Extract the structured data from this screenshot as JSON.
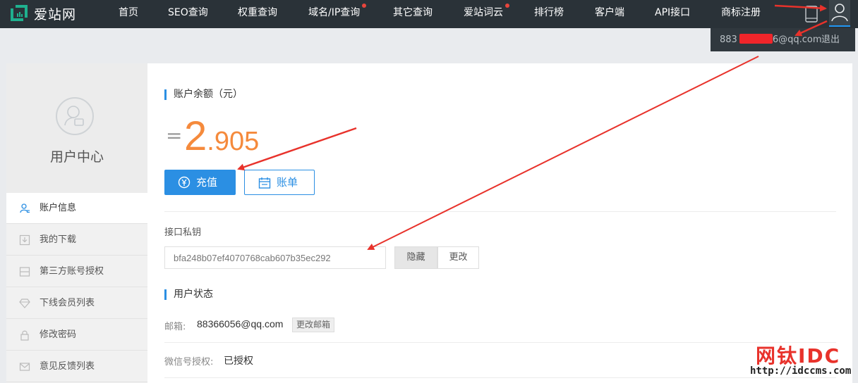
{
  "brand": {
    "name": "爱站网"
  },
  "nav": {
    "items": [
      {
        "label": "首页",
        "dot": false
      },
      {
        "label": "SEO查询",
        "dot": false
      },
      {
        "label": "权重查询",
        "dot": false
      },
      {
        "label": "域名/IP查询",
        "dot": true
      },
      {
        "label": "其它查询",
        "dot": false
      },
      {
        "label": "爱站词云",
        "dot": true
      },
      {
        "label": "排行榜",
        "dot": false
      },
      {
        "label": "客户端",
        "dot": false
      },
      {
        "label": "API接口",
        "dot": false
      },
      {
        "label": "商标注册",
        "dot": false
      }
    ]
  },
  "user_menu": {
    "email_prefix": "883",
    "email_suffix": "6@qq.com",
    "logout": "退出"
  },
  "sidebar": {
    "title": "用户中心",
    "items": [
      {
        "label": "账户信息",
        "icon": "user-info-icon",
        "active": true
      },
      {
        "label": "我的下载",
        "icon": "download-icon",
        "active": false
      },
      {
        "label": "第三方账号授权",
        "icon": "card-icon",
        "active": false
      },
      {
        "label": "下线会员列表",
        "icon": "diamond-icon",
        "active": false
      },
      {
        "label": "修改密码",
        "icon": "lock-icon",
        "active": false
      },
      {
        "label": "意见反馈列表",
        "icon": "mail-icon",
        "active": false
      }
    ]
  },
  "balance": {
    "title": "账户余额（元）",
    "prefix": "=",
    "integer": "2",
    "decimal": ".905",
    "charge_button": "充值",
    "bill_button": "账单"
  },
  "api_key": {
    "label": "接口私钥",
    "value": "bfa248b07ef4070768cab607b35ec292",
    "hide_button": "隐藏",
    "change_button": "更改"
  },
  "status": {
    "title": "用户状态",
    "email_label": "邮箱:",
    "email_value": "88366056@qq.com",
    "change_email_button": "更改邮箱",
    "wechat_label": "微信号授权:",
    "wechat_value": "已授权"
  },
  "watermark": {
    "title": "网钛IDC",
    "url": "http://idccms.com"
  },
  "colors": {
    "topbar": "#2a3238",
    "accent": "#2b8fe3",
    "amount": "#f58a3c",
    "annotation": "#e8322b"
  }
}
